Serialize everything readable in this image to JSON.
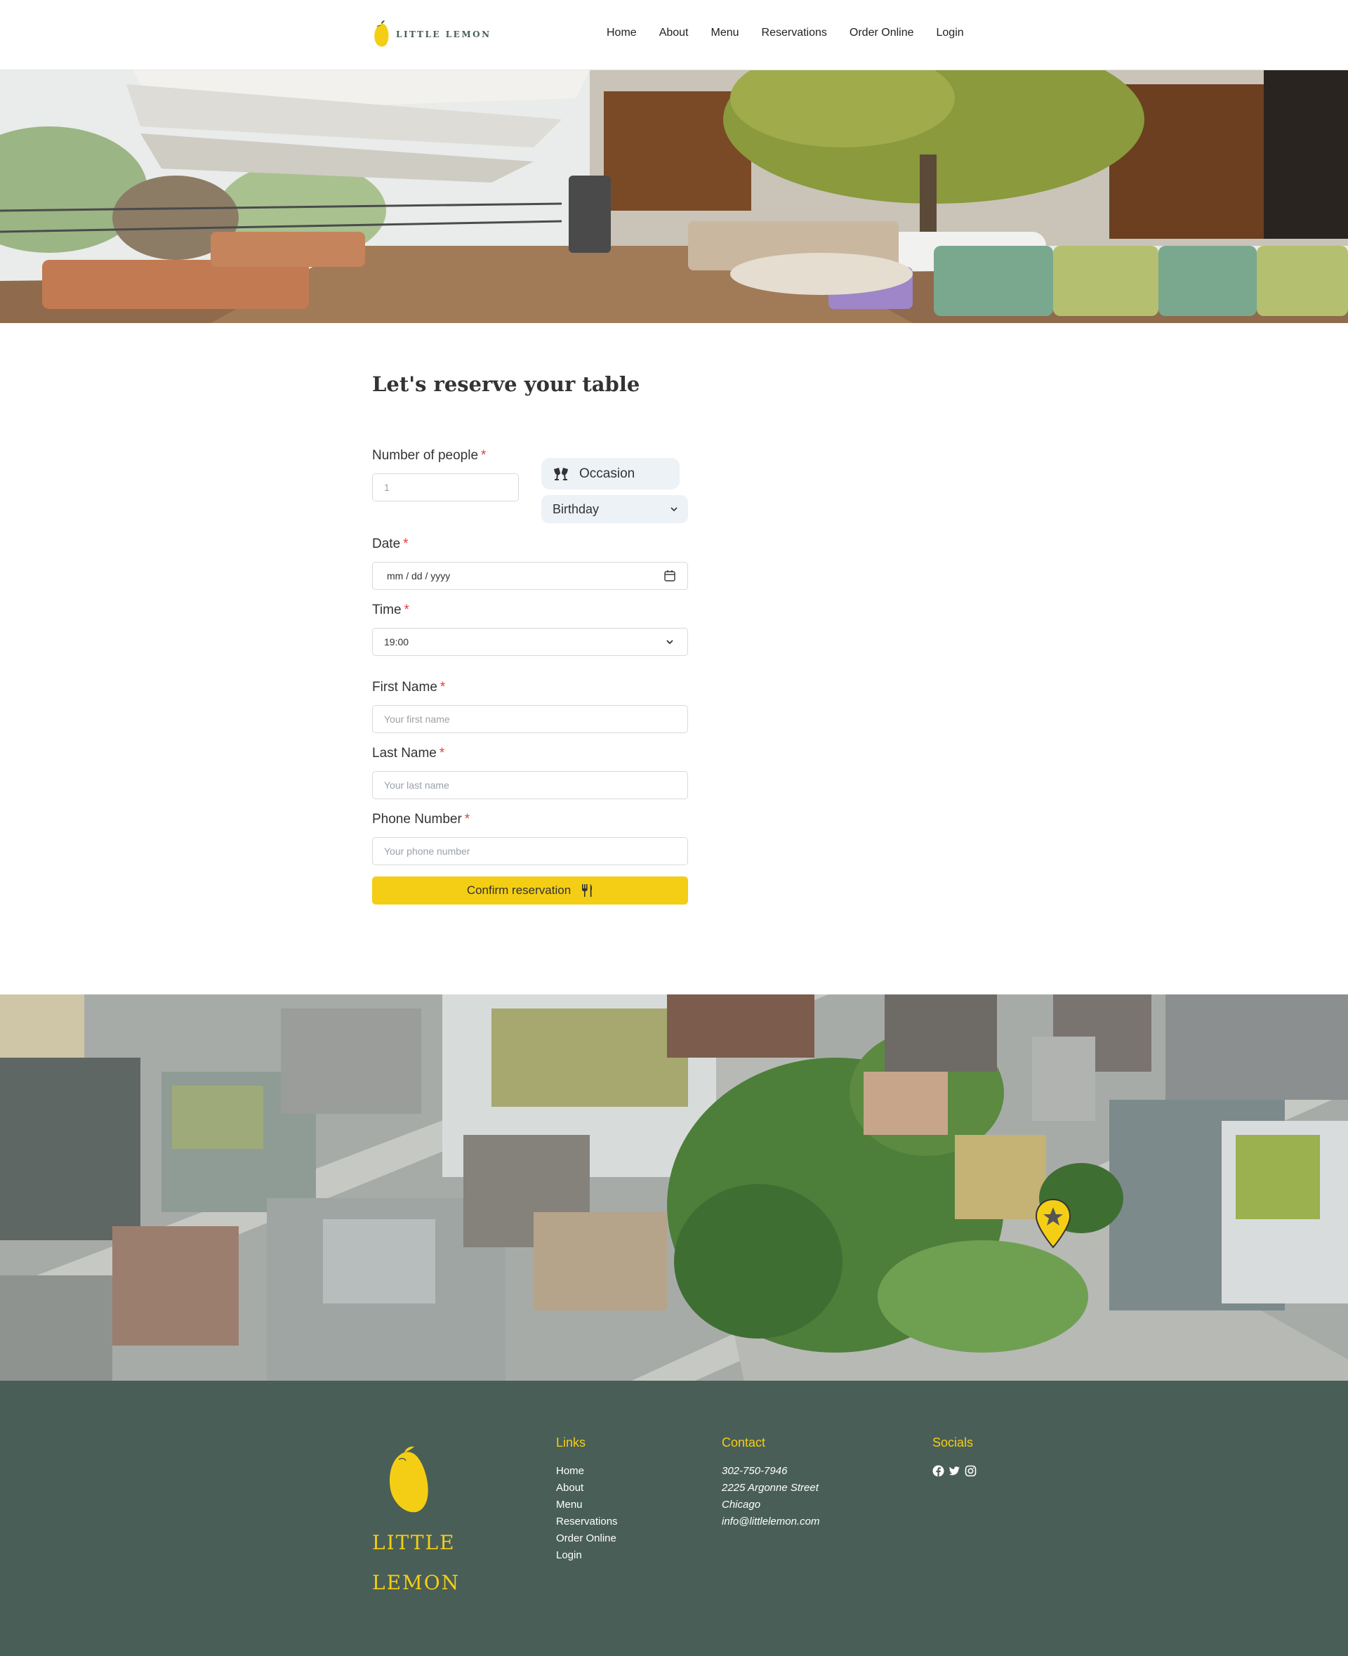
{
  "header": {
    "logo_text": "LITTLE LEMON",
    "nav": [
      "Home",
      "About",
      "Menu",
      "Reservations",
      "Order Online",
      "Login"
    ]
  },
  "form": {
    "title": "Let's reserve your table",
    "people": {
      "label": "Number of people",
      "placeholder": "1"
    },
    "occasion": {
      "label": "Occasion",
      "selected": "Birthday"
    },
    "date": {
      "label": "Date",
      "placeholder": "mm / dd / yyyy"
    },
    "time": {
      "label": "Time",
      "selected": "19:00"
    },
    "first_name": {
      "label": "First Name",
      "placeholder": "Your first name"
    },
    "last_name": {
      "label": "Last Name",
      "placeholder": "Your last name"
    },
    "phone": {
      "label": "Phone Number",
      "placeholder": "Your phone number"
    },
    "required_mark": "*",
    "confirm_label": "Confirm reservation"
  },
  "footer": {
    "brand_line1": "LITTLE",
    "brand_line2": "LEMON",
    "links_heading": "Links",
    "links": [
      "Home",
      "About",
      "Menu",
      "Reservations",
      "Order Online",
      "Login"
    ],
    "contact_heading": "Contact",
    "contact": [
      "302-750-7946",
      "2225 Argonne Street",
      "Chicago",
      "info@littlelemon.com"
    ],
    "socials_heading": "Socials",
    "socials": [
      "facebook-icon",
      "twitter-icon",
      "instagram-icon"
    ]
  },
  "colors": {
    "primary_green": "#495e57",
    "primary_yellow": "#f4ce14",
    "required_red": "#e53e3e"
  }
}
